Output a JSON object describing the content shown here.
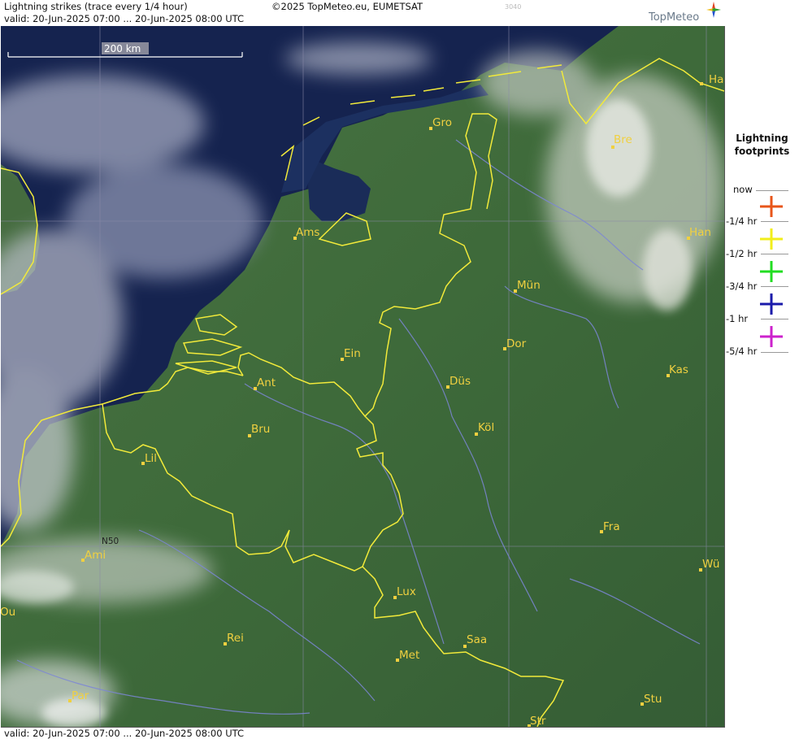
{
  "header": {
    "title": "Lightning strikes (trace every 1/4 hour)",
    "validity": "valid:  20-Jun-2025 07:00 ... 20-Jun-2025 08:00 UTC",
    "copyright": "©2025 TopMeteo.eu, EUMETSAT",
    "product_code": "3040",
    "logo_text": "TopMeteo"
  },
  "footer": {
    "validity": "valid:  20-Jun-2025 07:00 ... 20-Jun-2025 08:00 UTC"
  },
  "map": {
    "scale_label": "200 km",
    "latitude_label": "N50",
    "cities": [
      "Gro",
      "Bre",
      "Ha",
      "Ams",
      "Han",
      "Mün",
      "Dor",
      "Ein",
      "Ant",
      "Düs",
      "Kas",
      "Bru",
      "Köl",
      "Lil",
      "Fra",
      "Ami",
      "Wü",
      "Lux",
      "Ou",
      "Rei",
      "Saa",
      "Met",
      "Par",
      "Stu",
      "Str"
    ],
    "colors": {
      "sea": "#15234f",
      "land": "#3f6a3c",
      "border": "#f2ea3a",
      "river": "#7c86d6",
      "city_label": "#f0d040",
      "grid": "#8a8aa8"
    }
  },
  "legend": {
    "title_line1": "Lightning",
    "title_line2": "footprints",
    "entries": [
      {
        "label": "now",
        "color": null
      },
      {
        "label": "-1/4 hr",
        "color": "#e8561a"
      },
      {
        "label": "-1/2 hr",
        "color": "#f2ee1a"
      },
      {
        "label": "-3/4 hr",
        "color": "#22dd22"
      },
      {
        "label": "-1 hr",
        "color": "#1a1aaa"
      },
      {
        "label": "-5/4 hr",
        "color": "#cc22cc"
      }
    ]
  }
}
